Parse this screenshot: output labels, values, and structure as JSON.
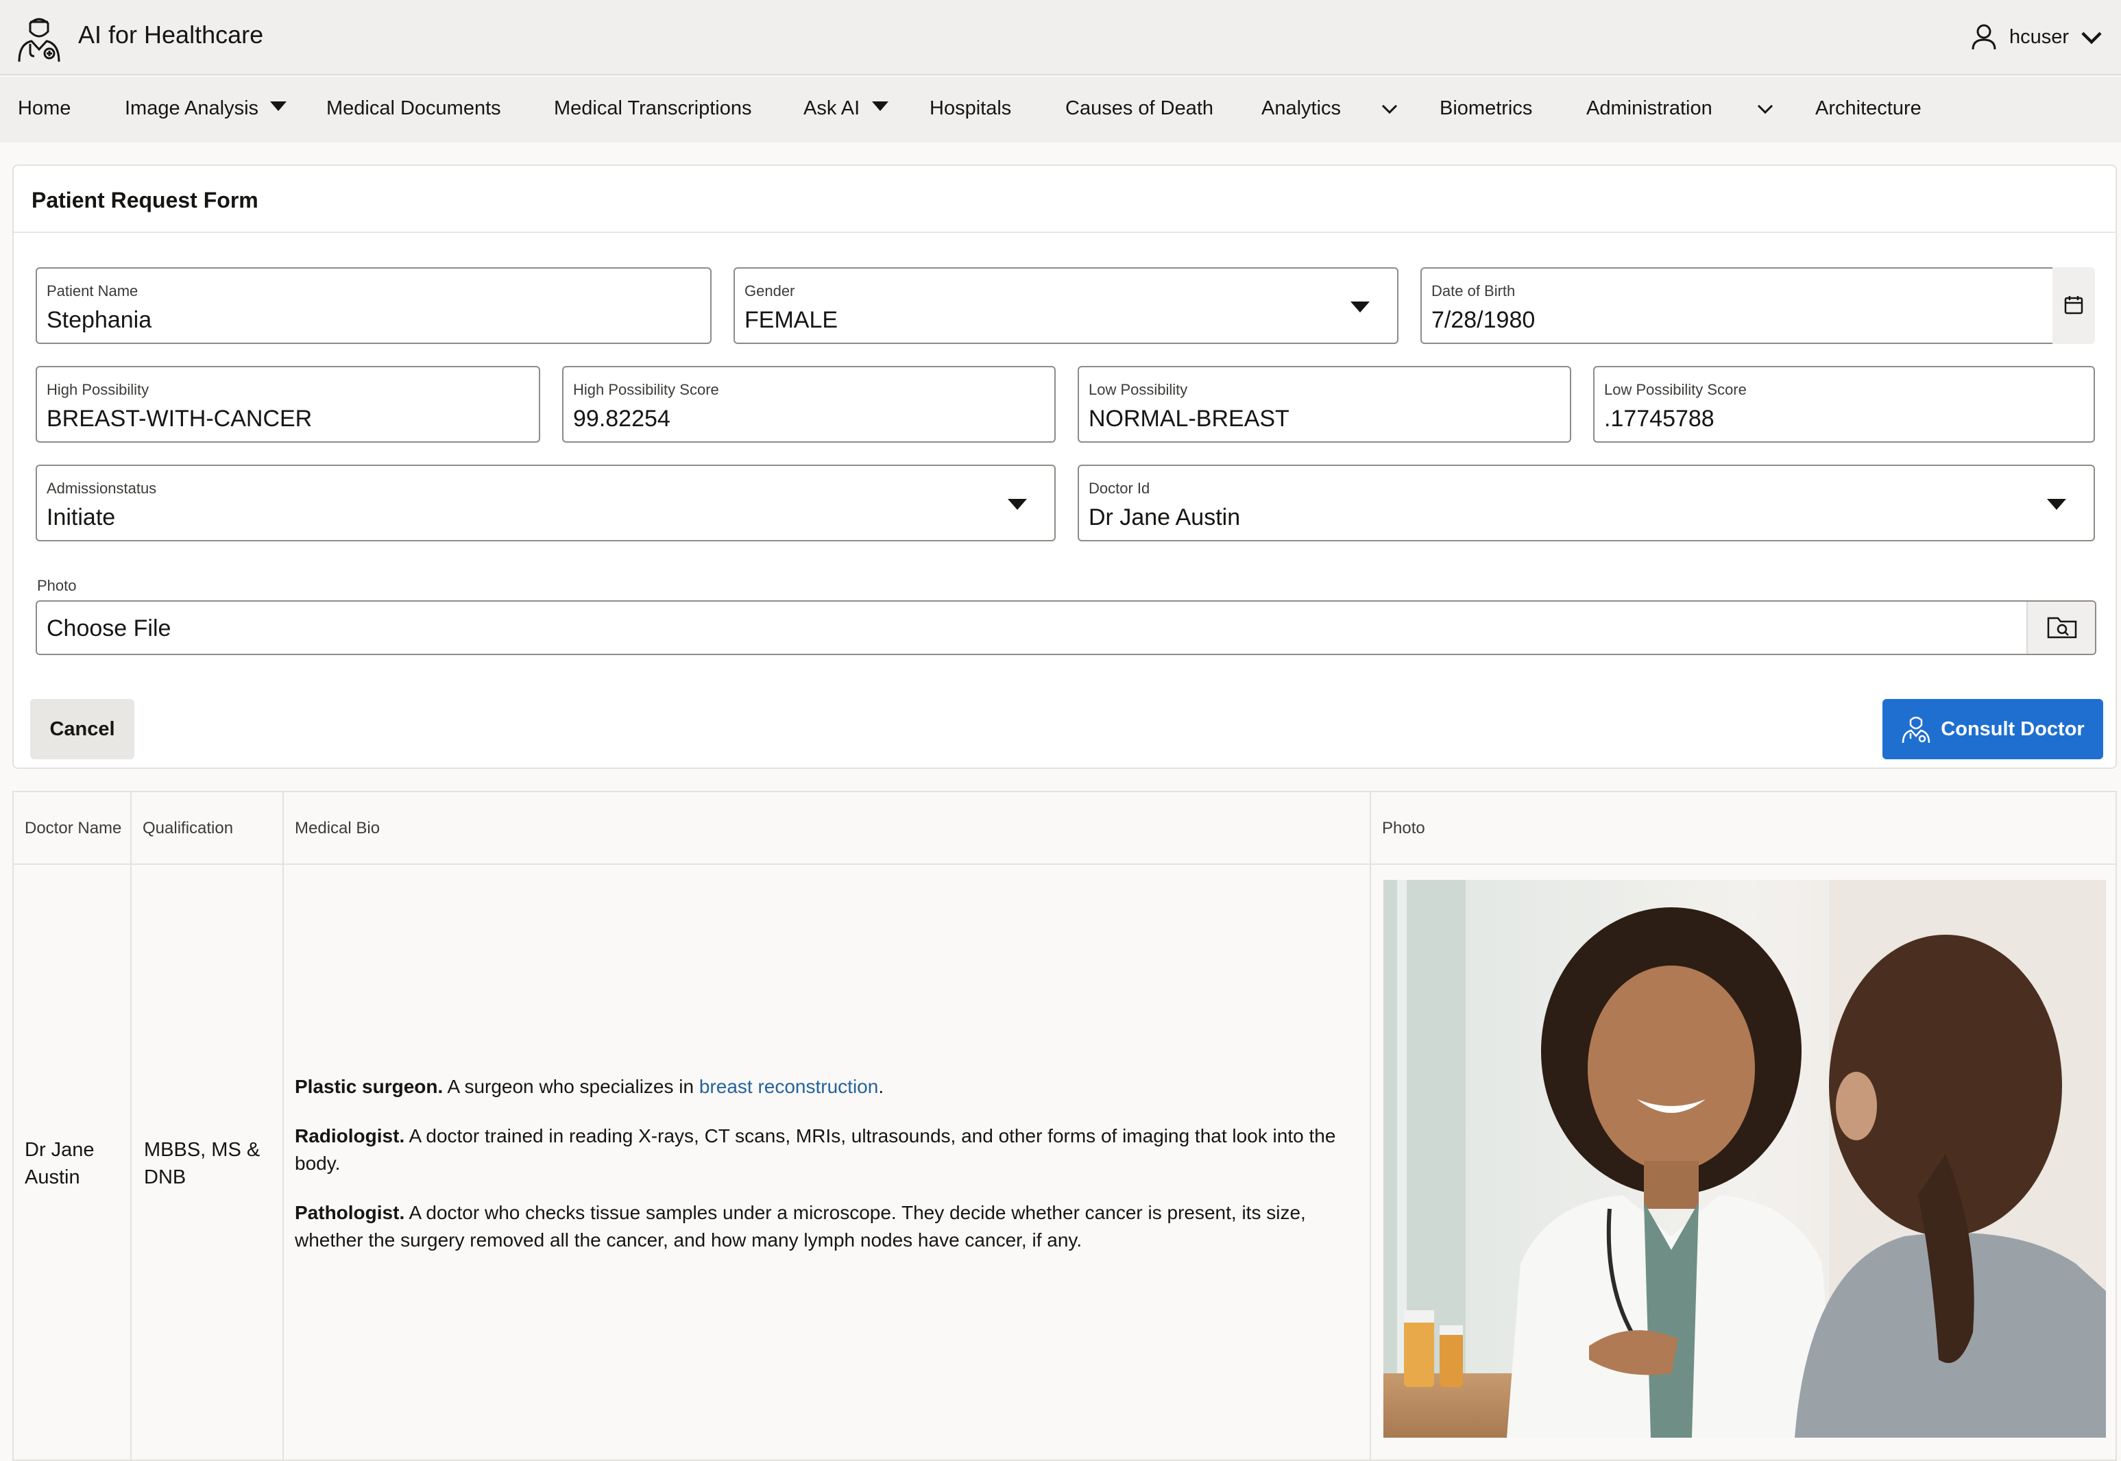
{
  "app": {
    "title": "AI for Healthcare",
    "user": "hcuser"
  },
  "nav": {
    "items": [
      "Home",
      "Image Analysis",
      "Medical Documents",
      "Medical Transcriptions",
      "Ask AI",
      "Hospitals",
      "Causes of Death",
      "Analytics",
      "Biometrics",
      "Administration",
      "Architecture"
    ]
  },
  "form": {
    "title": "Patient Request Form",
    "patient_name": {
      "label": "Patient Name",
      "value": "Stephania"
    },
    "gender": {
      "label": "Gender",
      "value": "FEMALE"
    },
    "dob": {
      "label": "Date of Birth",
      "value": "7/28/1980"
    },
    "high_possibility": {
      "label": "High Possibility",
      "value": "BREAST-WITH-CANCER"
    },
    "high_score": {
      "label": "High Possibility Score",
      "value": "99.82254"
    },
    "low_possibility": {
      "label": "Low Possibility",
      "value": "NORMAL-BREAST"
    },
    "low_score": {
      "label": "Low Possibility Score",
      "value": ".17745788"
    },
    "admission_status": {
      "label": "Admissionstatus",
      "value": "Initiate"
    },
    "doctor_id": {
      "label": "Doctor Id",
      "value": "Dr Jane Austin"
    },
    "photo": {
      "label": "Photo",
      "value": "Choose File"
    },
    "cancel_label": "Cancel",
    "consult_label": "Consult Doctor"
  },
  "table": {
    "headers": [
      "Doctor Name",
      "Qualification",
      "Medical Bio",
      "Photo"
    ],
    "row": {
      "doctor_name": "Dr Jane Austin",
      "qualification": "MBBS, MS & DNB",
      "bio": [
        {
          "title": "Plastic surgeon.",
          "text": " A surgeon who specializes in ",
          "link": "breast reconstruction",
          "tail": "."
        },
        {
          "title": "Radiologist.",
          "text": " A doctor trained in reading X-rays, CT scans, MRIs, ultrasounds, and other forms of imaging that look into the body."
        },
        {
          "title": "Pathologist.",
          "text": " A doctor who checks tissue samples under a microscope. They decide whether cancer is present, its size, whether the surgery removed all the cancer, and how many lymph nodes have cancer, if any."
        }
      ]
    }
  },
  "colors": {
    "primary": "#1e6fd0",
    "link": "#22639e",
    "nav_bg": "#f1efed"
  },
  "icons": {
    "brand": "doctor-icon",
    "user": "user-icon",
    "calendar": "calendar-icon",
    "file": "folder-search-icon"
  }
}
